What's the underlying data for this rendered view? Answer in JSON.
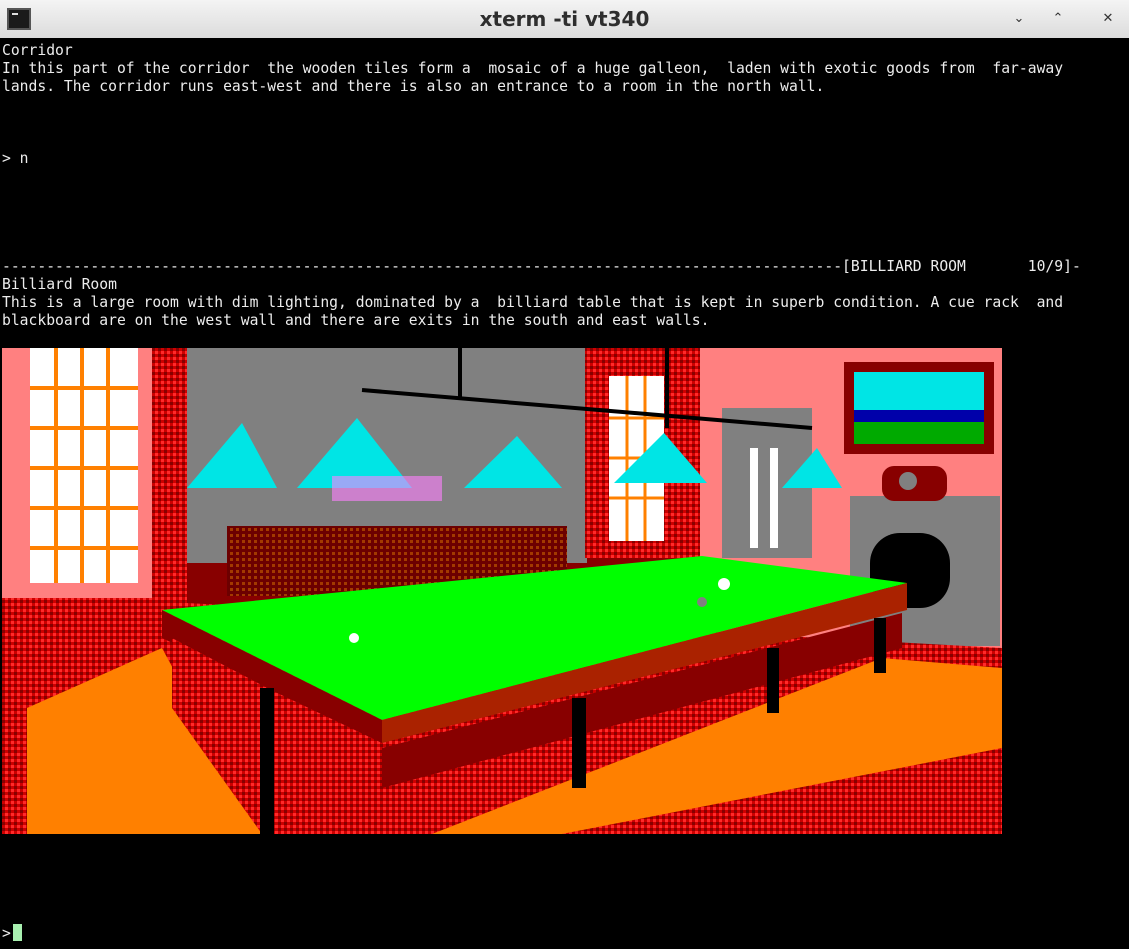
{
  "window": {
    "title": "xterm -ti vt340",
    "buttons": {
      "minimize": "⌄",
      "maximize": "⌃",
      "close": "✕"
    }
  },
  "terminal": {
    "lines": [
      "Corridor",
      "In this part of the corridor  the wooden tiles form a  mosaic of a huge galleon,  laden with exotic goods from  far-away",
      "lands. The corridor runs east-west and there is also an entrance to a room in the north wall.",
      "> n",
      "-----------------------------------------------------------------------------------------------[BILLIARD ROOM       10/9]-",
      "Billiard Room",
      "This is a large room with dim lighting, dominated by a  billiard table that is kept in superb condition. A cue rack  and",
      "blackboard are on the west wall and there are exits in the south and east walls."
    ],
    "prompt": ">"
  },
  "colors": {
    "background": "#000000",
    "text": "#ececec",
    "cursor": "#a8f0b0",
    "table_felt": "#00ff00",
    "lamp_shade": "#00e5e5",
    "wall_pink": "#ff8080",
    "wall_grey": "#808080",
    "floor_orange": "#ff8000",
    "wood_dark": "#880000"
  }
}
